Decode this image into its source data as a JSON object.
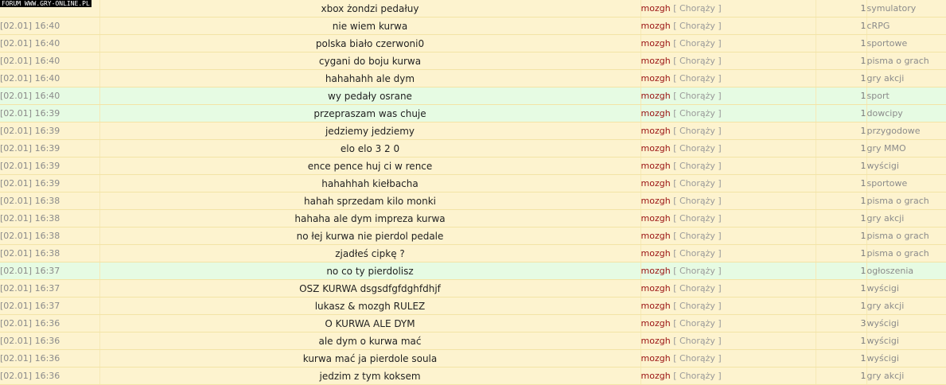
{
  "watermark": "FORUM WWW.GRY-ONLINE.PL",
  "rows": [
    {
      "date": "",
      "title": "xbox żondzi pedałuy",
      "nick": "mozgh",
      "rank": "[ Chorąży ]",
      "count": "1",
      "forum": "symulatory",
      "highlight": false
    },
    {
      "date": "[02.01] 16:40",
      "title": "nie wiem kurwa",
      "nick": "mozgh",
      "rank": "[ Chorąży ]",
      "count": "1",
      "forum": "cRPG",
      "highlight": false
    },
    {
      "date": "[02.01] 16:40",
      "title": "polska biało czerwoni0",
      "nick": "mozgh",
      "rank": "[ Chorąży ]",
      "count": "1",
      "forum": "sportowe",
      "highlight": false
    },
    {
      "date": "[02.01] 16:40",
      "title": "cygani do boju kurwa",
      "nick": "mozgh",
      "rank": "[ Chorąży ]",
      "count": "1",
      "forum": "pisma o grach",
      "highlight": false
    },
    {
      "date": "[02.01] 16:40",
      "title": "hahahahh ale dym",
      "nick": "mozgh",
      "rank": "[ Chorąży ]",
      "count": "1",
      "forum": "gry akcji",
      "highlight": false
    },
    {
      "date": "[02.01] 16:40",
      "title": "wy pedały osrane",
      "nick": "mozgh",
      "rank": "[ Chorąży ]",
      "count": "1",
      "forum": "sport",
      "highlight": true
    },
    {
      "date": "[02.01] 16:39",
      "title": "przepraszam was chuje",
      "nick": "mozgh",
      "rank": "[ Chorąży ]",
      "count": "1",
      "forum": "dowcipy",
      "highlight": true
    },
    {
      "date": "[02.01] 16:39",
      "title": "jedziemy jedziemy",
      "nick": "mozgh",
      "rank": "[ Chorąży ]",
      "count": "1",
      "forum": "przygodowe",
      "highlight": false
    },
    {
      "date": "[02.01] 16:39",
      "title": "elo elo 3 2 0",
      "nick": "mozgh",
      "rank": "[ Chorąży ]",
      "count": "1",
      "forum": "gry MMO",
      "highlight": false
    },
    {
      "date": "[02.01] 16:39",
      "title": "ence pence huj ci w rence",
      "nick": "mozgh",
      "rank": "[ Chorąży ]",
      "count": "1",
      "forum": "wyścigi",
      "highlight": false
    },
    {
      "date": "[02.01] 16:39",
      "title": "hahahhah kiełbacha",
      "nick": "mozgh",
      "rank": "[ Chorąży ]",
      "count": "1",
      "forum": "sportowe",
      "highlight": false
    },
    {
      "date": "[02.01] 16:38",
      "title": "hahah sprzedam kilo monki",
      "nick": "mozgh",
      "rank": "[ Chorąży ]",
      "count": "1",
      "forum": "pisma o grach",
      "highlight": false
    },
    {
      "date": "[02.01] 16:38",
      "title": "hahaha ale dym impreza kurwa",
      "nick": "mozgh",
      "rank": "[ Chorąży ]",
      "count": "1",
      "forum": "gry akcji",
      "highlight": false
    },
    {
      "date": "[02.01] 16:38",
      "title": "no łej kurwa nie pierdol pedale",
      "nick": "mozgh",
      "rank": "[ Chorąży ]",
      "count": "1",
      "forum": "pisma o grach",
      "highlight": false
    },
    {
      "date": "[02.01] 16:38",
      "title": "zjadłeś cipkę ?",
      "nick": "mozgh",
      "rank": "[ Chorąży ]",
      "count": "1",
      "forum": "pisma o grach",
      "highlight": false
    },
    {
      "date": "[02.01] 16:37",
      "title": "no co ty pierdolisz",
      "nick": "mozgh",
      "rank": "[ Chorąży ]",
      "count": "1",
      "forum": "ogłoszenia",
      "highlight": true
    },
    {
      "date": "[02.01] 16:37",
      "title": "OSZ KURWA dsgsdfgfdghfdhjf",
      "nick": "mozgh",
      "rank": "[ Chorąży ]",
      "count": "1",
      "forum": "wyścigi",
      "highlight": false
    },
    {
      "date": "[02.01] 16:37",
      "title": "lukasz & mozgh RULEZ",
      "nick": "mozgh",
      "rank": "[ Chorąży ]",
      "count": "1",
      "forum": "gry akcji",
      "highlight": false
    },
    {
      "date": "[02.01] 16:36",
      "title": "O KURWA ALE DYM",
      "nick": "mozgh",
      "rank": "[ Chorąży ]",
      "count": "3",
      "forum": "wyścigi",
      "highlight": false
    },
    {
      "date": "[02.01] 16:36",
      "title": "ale dym o kurwa mać",
      "nick": "mozgh",
      "rank": "[ Chorąży ]",
      "count": "1",
      "forum": "wyścigi",
      "highlight": false
    },
    {
      "date": "[02.01] 16:36",
      "title": "kurwa mać ja pierdole soula",
      "nick": "mozgh",
      "rank": "[ Chorąży ]",
      "count": "1",
      "forum": "wyścigi",
      "highlight": false
    },
    {
      "date": "[02.01] 16:36",
      "title": "jedzim z tym koksem",
      "nick": "mozgh",
      "rank": "[ Chorąży ]",
      "count": "1",
      "forum": "gry akcji",
      "highlight": false
    }
  ]
}
